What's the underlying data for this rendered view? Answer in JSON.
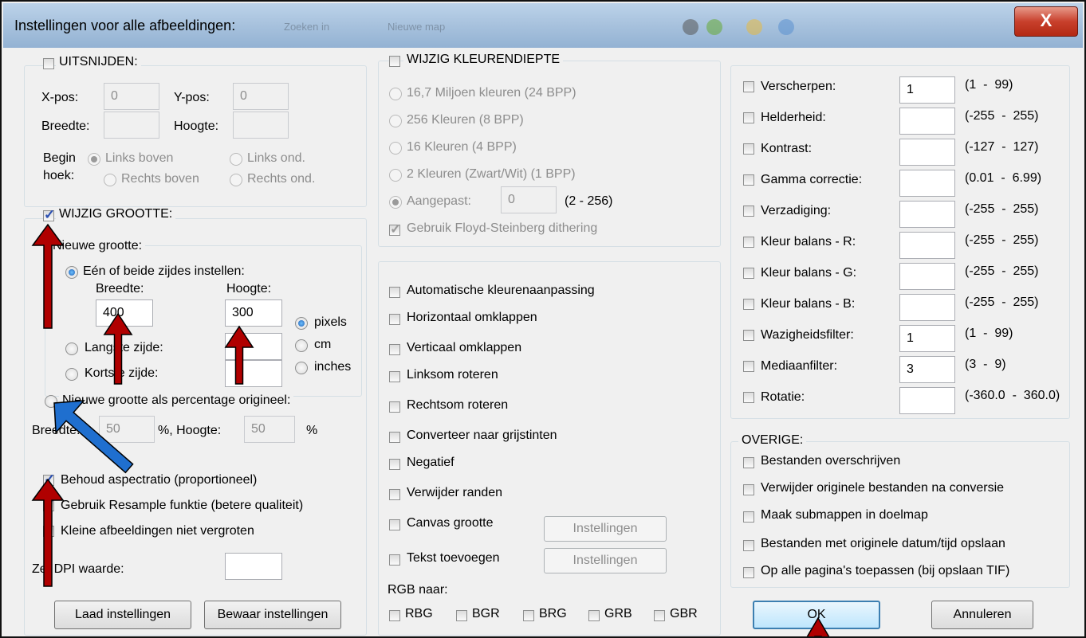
{
  "window": {
    "title": "Instellingen voor alle afbeeldingen:",
    "close_label": "X",
    "background_blur_text": [
      "Zoeken in",
      "Nieuwe map"
    ]
  },
  "crop": {
    "title": "UITSNIJDEN:",
    "checked": false,
    "xpos_label": "X-pos:",
    "xpos_value": "0",
    "ypos_label": "Y-pos:",
    "ypos_value": "0",
    "width_label": "Breedte:",
    "width_value": "",
    "height_label": "Hoogte:",
    "height_value": "",
    "corner_label_1": "Begin",
    "corner_label_2": "hoek:",
    "corner_options": [
      "Links boven",
      "Links ond.",
      "Rechts boven",
      "Rechts ond."
    ],
    "corner_selected": 0
  },
  "resize": {
    "title": "WIJZIG GROOTTE:",
    "checked": true,
    "new_size_label": "Nieuwe grootte:",
    "one_or_both_label": "Eén of beide zijdes instellen:",
    "width_label": "Breedte:",
    "height_label": "Hoogte:",
    "width_value": "400",
    "height_value": "300",
    "longest_label": "Langste zijde:",
    "shortest_label": "Kortste zijde:",
    "units": [
      "pixels",
      "cm",
      "inches"
    ],
    "unit_selected": 0,
    "percent_label": "Nieuwe grootte als percentage origineel:",
    "percent_width_label": "Breedte:",
    "percent_width_value": "50",
    "percent_sep": "%, Hoogte:",
    "percent_height_value": "50",
    "percent_sign": "%",
    "keep_aspect": "Behoud aspectratio (proportioneel)",
    "keep_aspect_checked": true,
    "resample": "Gebruik Resample funktie (betere qualiteit)",
    "resample_checked": true,
    "no_enlarge": "Kleine afbeeldingen niet vergroten",
    "no_enlarge_checked": false,
    "dpi_label": "Zet DPI waarde:",
    "dpi_value": ""
  },
  "color_depth": {
    "title": "WIJZIG KLEURENDIEPTE",
    "checked": false,
    "options": [
      "16,7 Miljoen kleuren (24 BPP)",
      "256 Kleuren (8 BPP)",
      "16 Kleuren (4 BPP)",
      "2 Kleuren (Zwart/Wit) (1 BPP)"
    ],
    "custom_label": "Aangepast:",
    "custom_value": "0",
    "custom_range": "(2 - 256)",
    "dithering": "Gebruik Floyd-Steinberg dithering",
    "dithering_checked": true
  },
  "transforms": {
    "items": [
      "Automatische kleurenaanpassing",
      "Horizontaal omklappen",
      "Verticaal omklappen",
      "Linksom roteren",
      "Rechtsom roteren",
      "Converteer naar grijstinten",
      "Negatief",
      "Verwijder randen"
    ],
    "canvas_label": "Canvas grootte",
    "text_label": "Tekst toevoegen",
    "settings_button": "Instellingen",
    "rgb_label": "RGB naar:",
    "rgb_options": [
      "RBG",
      "BGR",
      "BRG",
      "GRB",
      "GBR"
    ]
  },
  "adjustments": [
    {
      "label": "Verscherpen:",
      "value": "1",
      "range": "(1  -  99)"
    },
    {
      "label": "Helderheid:",
      "value": "",
      "range": "(-255  -  255)"
    },
    {
      "label": "Kontrast:",
      "value": "",
      "range": "(-127  -  127)"
    },
    {
      "label": "Gamma correctie:",
      "value": "",
      "range": "(0.01  -  6.99)"
    },
    {
      "label": "Verzadiging:",
      "value": "",
      "range": "(-255  -  255)"
    },
    {
      "label": "Kleur balans - R:",
      "value": "",
      "range": "(-255  -  255)"
    },
    {
      "label": "Kleur balans - G:",
      "value": "",
      "range": "(-255  -  255)"
    },
    {
      "label": "Kleur balans - B:",
      "value": "",
      "range": "(-255  -  255)"
    },
    {
      "label": "Wazigheidsfilter:",
      "value": "1",
      "range": "(1  -  99)"
    },
    {
      "label": "Mediaanfilter:",
      "value": "3",
      "range": "(3  -  9)"
    },
    {
      "label": "Rotatie:",
      "value": "",
      "range": "(-360.0  -  360.0)"
    }
  ],
  "other": {
    "title": "OVERIGE:",
    "items": [
      "Bestanden overschrijven",
      "Verwijder originele bestanden na conversie",
      "Maak submappen in doelmap",
      "Bestanden met originele datum/tijd opslaan",
      "Op alle pagina's toepassen (bij opslaan TIF)"
    ]
  },
  "buttons": {
    "load": "Laad instellingen",
    "save": "Bewaar instellingen",
    "ok": "OK",
    "cancel": "Annuleren"
  },
  "colors": {
    "annotation_red": "#b00000",
    "annotation_blue": "#1f6fcf"
  }
}
